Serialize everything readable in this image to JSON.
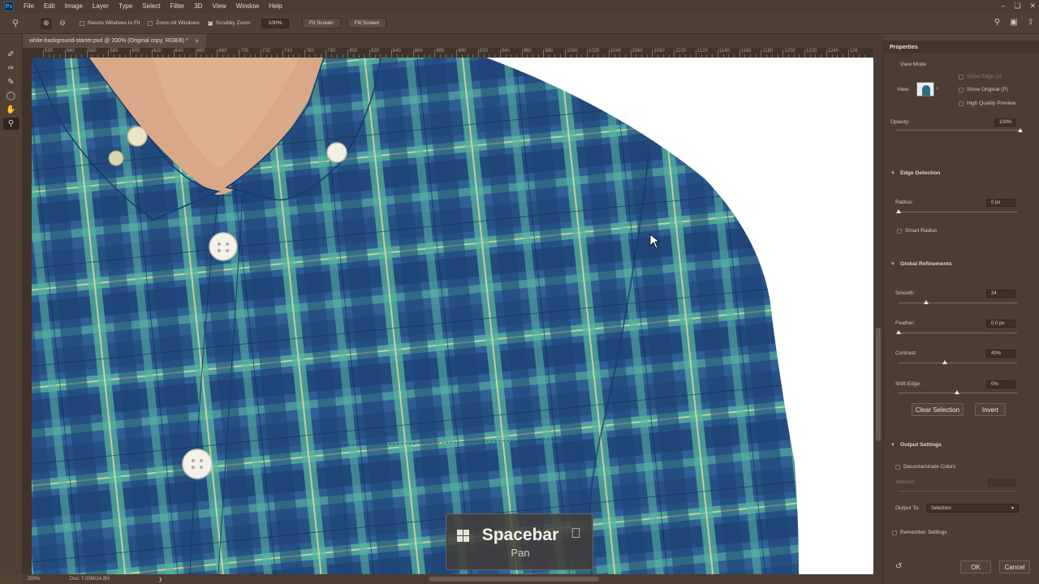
{
  "menu": [
    "File",
    "Edit",
    "Image",
    "Layer",
    "Type",
    "Select",
    "Filter",
    "3D",
    "View",
    "Window",
    "Help"
  ],
  "options_bar": {
    "resize_windows": "Resize Windows to Fit",
    "zoom_all": "Zoom All Windows",
    "scrubby_zoom": "Scrubby Zoom",
    "zoom_value": "100%",
    "fit_screen": "Fit Screen",
    "fill_screen": "Fill Screen",
    "resize_checked": false,
    "zoom_all_checked": false,
    "scrubby_checked": true
  },
  "document": {
    "tab_title": "white-background-starter.psd @ 200% (Original copy, RGB/8) *"
  },
  "ruler_labels": [
    "520",
    "540",
    "560",
    "580",
    "600",
    "620",
    "640",
    "660",
    "680",
    "700",
    "720",
    "740",
    "760",
    "780",
    "800",
    "820",
    "840",
    "860",
    "880",
    "900",
    "920",
    "940",
    "960",
    "980",
    "1000",
    "1020",
    "1040",
    "1060",
    "1080",
    "1100",
    "1120",
    "1140",
    "1160",
    "1180",
    "1200",
    "1220",
    "1240",
    "126"
  ],
  "status": {
    "zoom": "200%",
    "doc_info": "Doc: 7.00M/24.8M"
  },
  "properties": {
    "title": "Properties",
    "view_mode": "View Mode",
    "view_label": "View:",
    "show_edge": "Show Edge (J)",
    "show_original": "Show Original (P)",
    "high_quality": "High Quality Preview",
    "opacity_label": "Opacity:",
    "opacity_value": "100%",
    "opacity_level": 1.0,
    "edge_detection": "Edge Detection",
    "radius_label": "Radius:",
    "radius_value": "0 px",
    "radius_level": 0.0,
    "smart_radius": "Smart Radius",
    "global_refinements": "Global Refinements",
    "smooth_label": "Smooth:",
    "smooth_value": "24",
    "smooth_level": 0.24,
    "feather_label": "Feather:",
    "feather_value": "0.0 px",
    "feather_level": 0.0,
    "contrast_label": "Contrast:",
    "contrast_value": "40%",
    "contrast_level": 0.4,
    "shift_label": "Shift Edge:",
    "shift_value": "0%",
    "shift_level": 0.5,
    "clear_selection": "Clear Selection",
    "invert": "Invert",
    "output_settings": "Output Settings",
    "decontaminate": "Decontaminate Colors",
    "amount_label": "Amount:",
    "output_to_label": "Output To:",
    "output_to_value": "Selection",
    "remember": "Remember Settings",
    "ok": "OK",
    "cancel": "Cancel"
  },
  "overlay": {
    "key": "Spacebar",
    "action": "Pan"
  },
  "colors": {
    "app_bg": "#524337",
    "panel_bg": "#4b3d33",
    "shirt_base": "#2f5f93",
    "shirt_green": "#58b8a0",
    "ok_blue": "#1473e6"
  }
}
